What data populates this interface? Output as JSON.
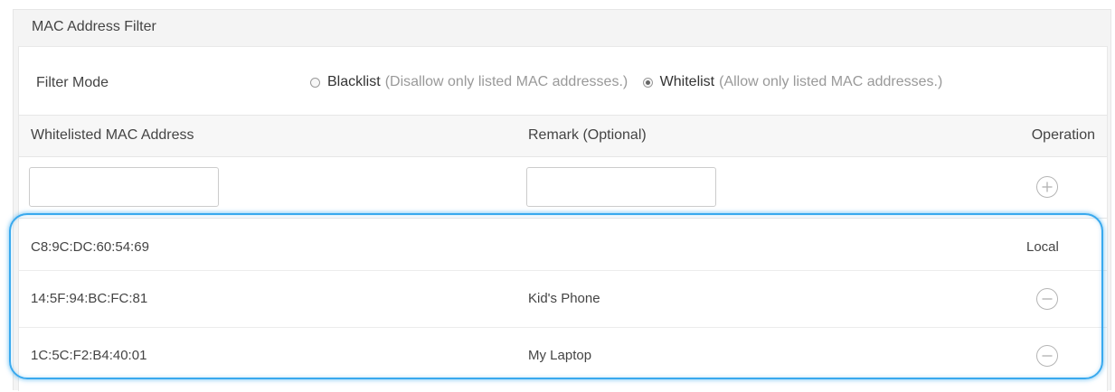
{
  "panel": {
    "title": "MAC Address Filter"
  },
  "filter_mode": {
    "label": "Filter Mode",
    "options": [
      {
        "name": "Blacklist",
        "description": "(Disallow only listed MAC addresses.)",
        "checked": false
      },
      {
        "name": "Whitelist",
        "description": "(Allow only listed MAC addresses.)",
        "checked": true
      }
    ]
  },
  "table": {
    "headers": {
      "mac": "Whitelisted MAC Address",
      "remark": "Remark (Optional)",
      "operation": "Operation"
    },
    "new_entry": {
      "mac_value": "",
      "remark_value": "",
      "add_icon": "plus-circle-icon"
    },
    "rows": [
      {
        "mac": "C8:9C:DC:60:54:69",
        "remark": "",
        "operation": "Local"
      },
      {
        "mac": "14:5F:94:BC:FC:81",
        "remark": "Kid's Phone",
        "operation_icon": "minus-circle-icon"
      },
      {
        "mac": "1C:5C:F2:B4:40:01",
        "remark": "My Laptop",
        "operation_icon": "minus-circle-icon"
      }
    ]
  },
  "colors": {
    "highlight": "#39a9ee",
    "border": "#e6e6e6",
    "muted_text": "#999999"
  }
}
